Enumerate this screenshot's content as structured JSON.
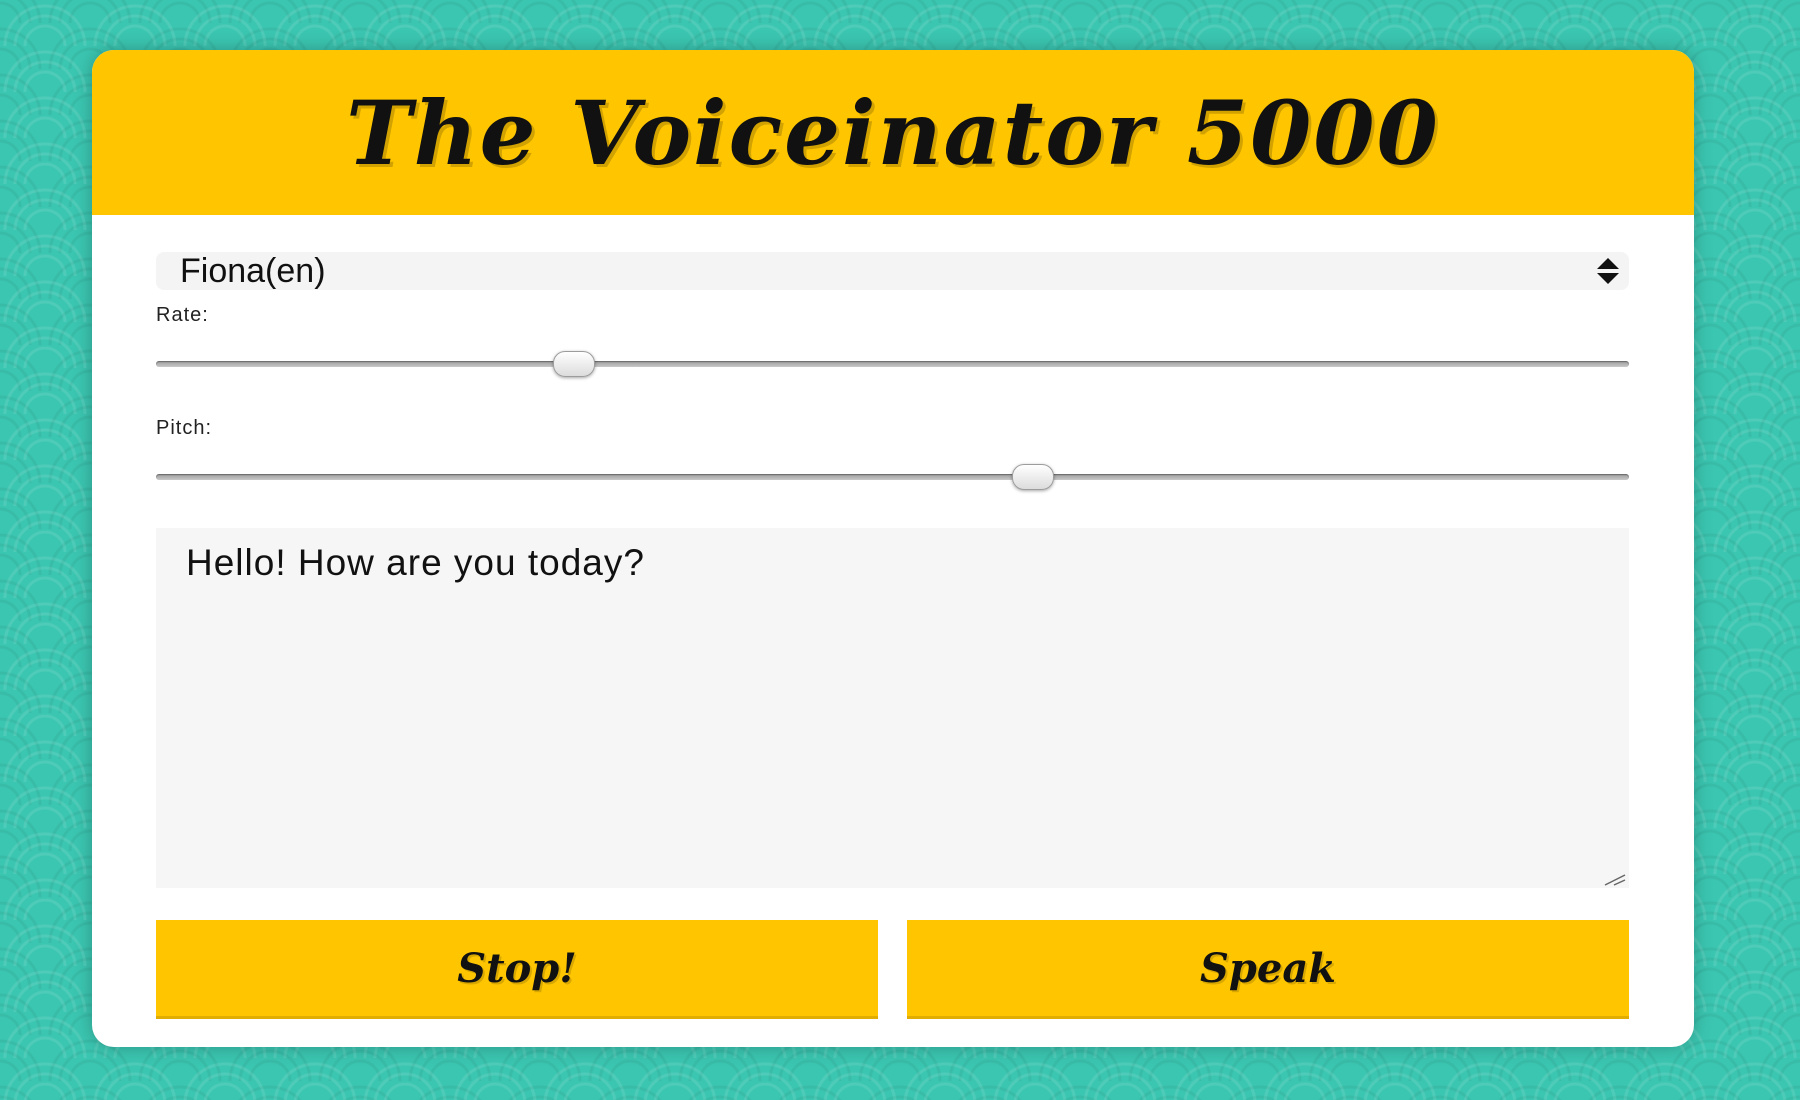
{
  "app": {
    "title": "The Voiceinator 5000"
  },
  "voice_select": {
    "selected": "Fiona(en)"
  },
  "rate": {
    "label": "Rate:",
    "fill_fraction": 0.283
  },
  "pitch": {
    "label": "Pitch:",
    "fill_fraction": 0.595
  },
  "message": {
    "value": "Hello! How are you today?"
  },
  "buttons": {
    "stop_label": "Stop!",
    "speak_label": "Speak"
  },
  "colors": {
    "accent": "#ffc600",
    "background": "#3bc6b1",
    "card": "#ffffff"
  },
  "icons": {
    "select_arrows": "up-down-arrows-icon",
    "resize_grip": "resize-grip-icon"
  }
}
